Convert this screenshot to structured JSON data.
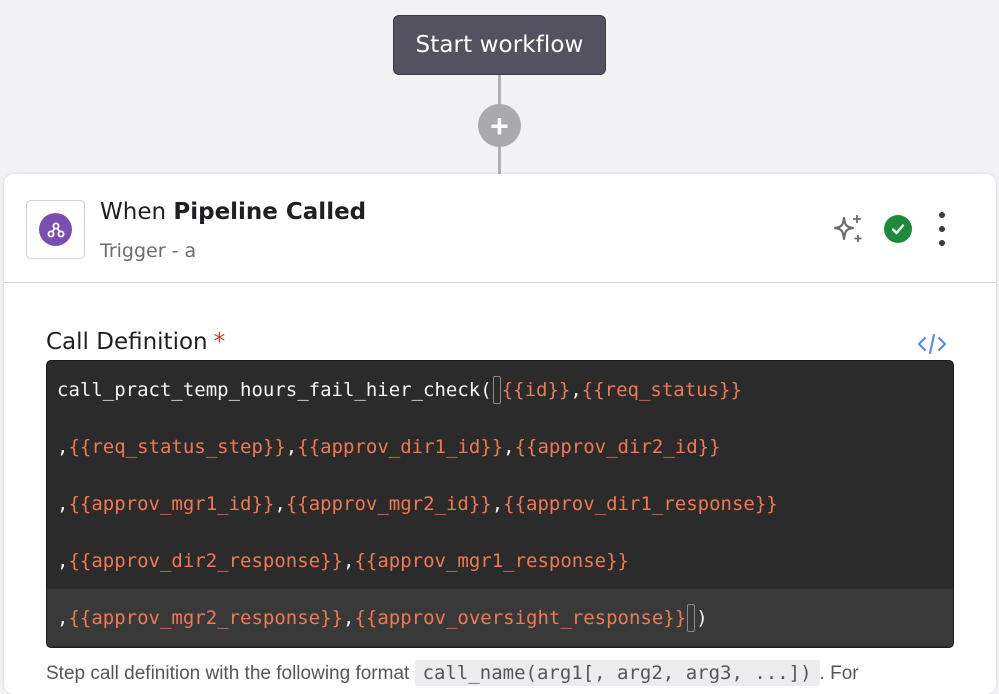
{
  "workflow": {
    "start_label": "Start workflow",
    "add_symbol": "+"
  },
  "step": {
    "title_prefix": "When ",
    "title_bold": "Pipeline Called",
    "subtitle": "Trigger - a",
    "icons": {
      "trigger": "pipeline-icon",
      "ai": "sparkle-icon",
      "status": "check-circle-icon",
      "menu": "kebab-menu-icon",
      "code_toggle": "code-icon"
    },
    "colors": {
      "trigger": "#7b4db0",
      "status_ok": "#1d8a3b",
      "code_toggle": "#5b8def"
    }
  },
  "field": {
    "label": "Call Definition",
    "required_marker": "*",
    "code_lines": [
      [
        "call_pract_temp_hours_fail_hier_check(",
        "{{id}}",
        ",",
        "{{req_status}}"
      ],
      [
        ",",
        "{{req_status_step}}",
        ",",
        "{{approv_dir1_id}}",
        ",",
        "{{approv_dir2_id}}"
      ],
      [
        ",",
        "{{approv_mgr1_id}}",
        ",",
        "{{approv_mgr2_id}}",
        ",",
        "{{approv_dir1_response}}"
      ],
      [
        ",",
        "{{approv_dir2_response}}",
        ",",
        "{{approv_mgr1_response}}"
      ],
      [
        ",",
        "{{approv_mgr2_response}}",
        ",",
        "{{approv_oversight_response}}",
        ")"
      ]
    ],
    "help_prefix": "Step call definition with the following format",
    "help_code": "call_name(arg1[, arg2, arg3, ...])",
    "help_suffix": ". For"
  }
}
